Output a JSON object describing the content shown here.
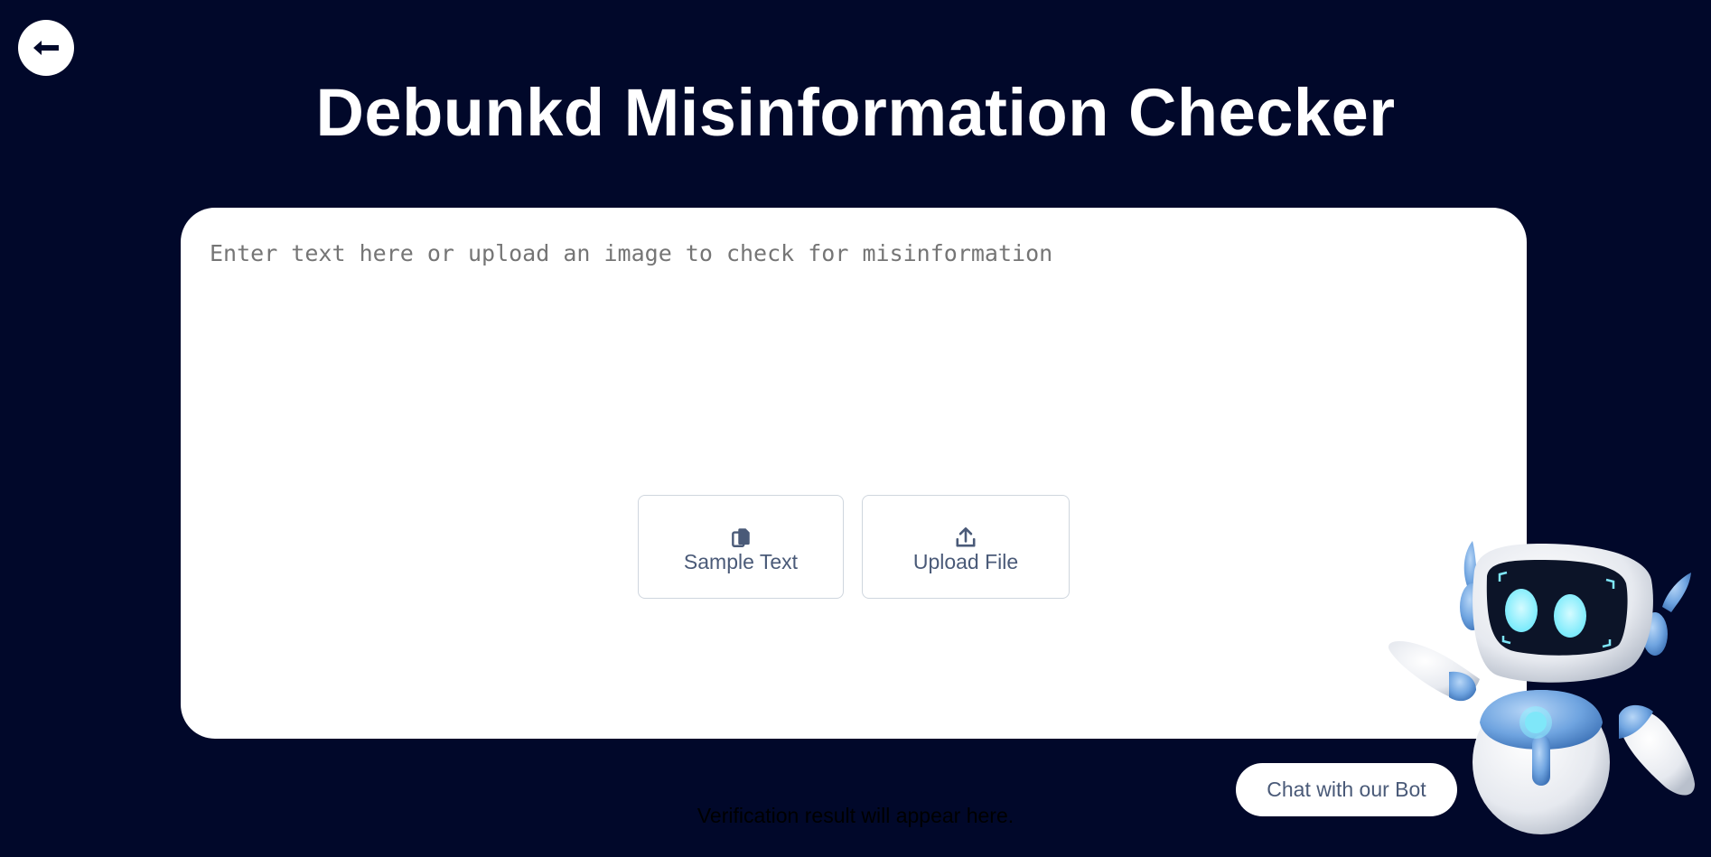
{
  "header": {
    "back_button_icon": "arrow-left-icon",
    "title": "Debunkd Misinformation Checker"
  },
  "checker": {
    "input_placeholder": "Enter text here or upload an image to check for misinformation",
    "input_value": "",
    "sample_button": {
      "label": "Sample Text",
      "icon": "clipboard-copy-icon"
    },
    "upload_button": {
      "label": "Upload File",
      "icon": "upload-icon"
    }
  },
  "result": {
    "text": "Verification result will appear here."
  },
  "chatbot": {
    "button_label": "Chat with our Bot",
    "illustration": "robot-mascot-icon"
  },
  "colors": {
    "background": "#01082a",
    "card": "#ffffff",
    "button_text": "#4a5a78",
    "robot_blue": "#6fa4e0",
    "robot_eye": "#8ef3ff"
  }
}
